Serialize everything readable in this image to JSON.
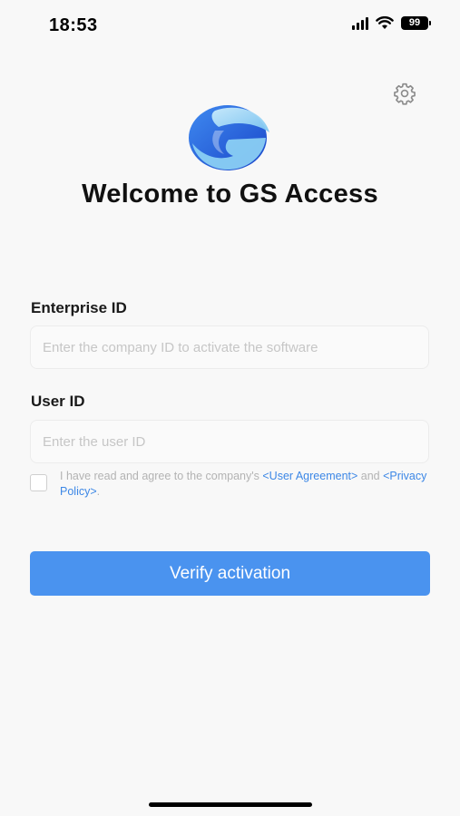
{
  "status_bar": {
    "time": "18:53",
    "battery_level": "99",
    "icons": [
      "signal-icon",
      "wifi-icon",
      "battery-icon"
    ]
  },
  "header": {
    "settings_icon": "gear-icon",
    "logo_icon": "gs-logo",
    "title": "Welcome to GS Access"
  },
  "form": {
    "enterprise_id": {
      "label": "Enterprise ID",
      "value": "",
      "placeholder": "Enter the company ID to activate the software"
    },
    "user_id": {
      "label": "User ID",
      "value": "",
      "placeholder": "Enter the user ID"
    },
    "agreement": {
      "checked": false,
      "prefix": "I have read and agree to the company's ",
      "user_agreement_link": "<User Agreement>",
      "middle": " and ",
      "privacy_policy_link": "<Privacy Policy>",
      "suffix": "."
    },
    "submit_label": "Verify activation"
  },
  "colors": {
    "primary": "#4a93ef",
    "link": "#3c87e6",
    "background": "#f8f8f8",
    "logo_dark": "#1f58d6",
    "logo_light": "#8fd4f5"
  }
}
